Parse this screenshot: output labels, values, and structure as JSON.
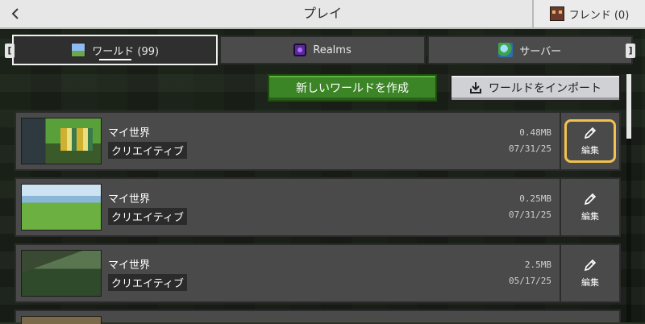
{
  "header": {
    "back_icon": "chevron-left-icon",
    "title": "プレイ",
    "friends_label": "フレンド (0)"
  },
  "tabs": [
    {
      "label": "ワールド (99)",
      "icon": "world-icon",
      "active": true
    },
    {
      "label": "Realms",
      "icon": "realms-icon",
      "active": false
    },
    {
      "label": "サーバー",
      "icon": "server-icon",
      "active": false
    }
  ],
  "tab_keys": {
    "left": "[",
    "right": "]"
  },
  "actions": {
    "create_label": "新しいワールドを作成",
    "import_label": "ワールドをインポート",
    "import_icon": "import-icon"
  },
  "worlds": [
    {
      "name": "マイ世界",
      "mode": "クリエイティブ",
      "size": "0.48MB",
      "date": "07/31/25",
      "edit_label": "編集"
    },
    {
      "name": "マイ世界",
      "mode": "クリエイティブ",
      "size": "0.25MB",
      "date": "07/31/25",
      "edit_label": "編集"
    },
    {
      "name": "マイ世界",
      "mode": "クリエイティブ",
      "size": "2.5MB",
      "date": "05/17/25",
      "edit_label": "編集"
    }
  ],
  "colors": {
    "create_button": "#3c8527",
    "import_button": "#d0d1d4",
    "focus_ring": "#f2c14e",
    "row_background": "#4a4a4a"
  }
}
